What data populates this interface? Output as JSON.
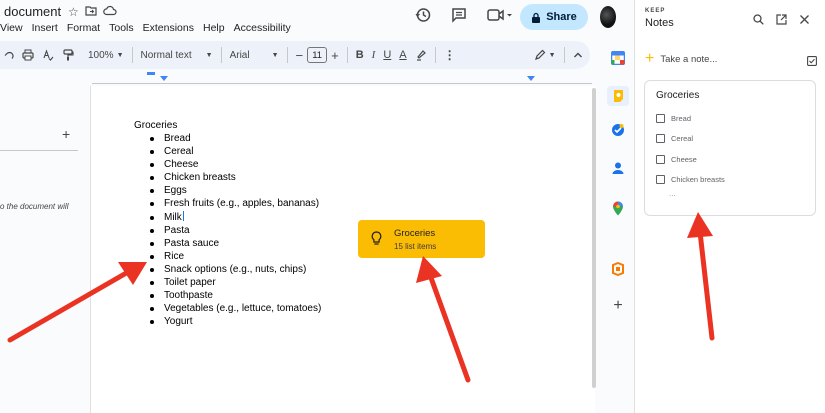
{
  "app": {
    "doc_title": "document",
    "menus": [
      "View",
      "Insert",
      "Format",
      "Tools",
      "Extensions",
      "Help",
      "Accessibility"
    ],
    "share_label": "Share"
  },
  "toolbar": {
    "zoom": "100%",
    "style": "Normal text",
    "font": "Arial",
    "font_size": "11",
    "minus": "−",
    "plus": "+",
    "bold": "B",
    "italic": "I",
    "underline": "U",
    "text_color": "A"
  },
  "outline": {
    "add": "+",
    "hint": "o the document will"
  },
  "document": {
    "heading": "Groceries",
    "items": [
      "Bread",
      "Cereal",
      "Cheese",
      "Chicken breasts",
      "Eggs",
      "Fresh fruits (e.g., apples, bananas)",
      "Milk",
      "Pasta",
      "Pasta sauce",
      "Rice",
      "Snack options (e.g., nuts, chips)",
      "Toilet paper",
      "Toothpaste",
      "Vegetables (e.g., lettuce, tomatoes)",
      "Yogurt"
    ]
  },
  "keep_chip": {
    "title": "Groceries",
    "subtitle": "15 list items"
  },
  "keep_panel": {
    "brand": "KEEP",
    "title": "Notes",
    "take_note": "Take a note...",
    "note": {
      "title": "Groceries",
      "items": [
        "Bread",
        "Cereal",
        "Cheese",
        "Chicken breasts"
      ],
      "more": "..."
    }
  },
  "colors": {
    "keep_yellow": "#fbbc04",
    "share_bg": "#c2e7ff",
    "toolbar_bg": "#edf2fa",
    "arrow_red": "#ea3323"
  }
}
